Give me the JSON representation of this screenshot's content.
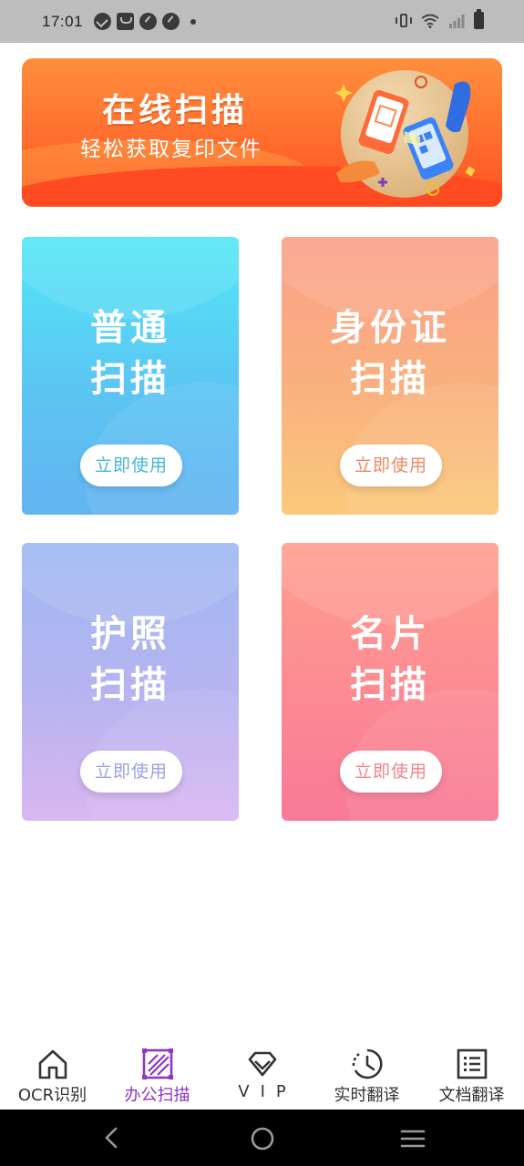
{
  "status_bar": {
    "time": "17:01"
  },
  "banner": {
    "title": "在线扫描",
    "subtitle": "轻松获取复印文件"
  },
  "cards": [
    {
      "title_line1": "普通",
      "title_line2": "扫描",
      "button": "立即使用"
    },
    {
      "title_line1": "身份证",
      "title_line2": "扫描",
      "button": "立即使用"
    },
    {
      "title_line1": "护照",
      "title_line2": "扫描",
      "button": "立即使用"
    },
    {
      "title_line1": "名片",
      "title_line2": "扫描",
      "button": "立即使用"
    }
  ],
  "bottom_nav": {
    "items": [
      {
        "label": "OCR识别",
        "icon": "home-icon"
      },
      {
        "label": "办公扫描",
        "icon": "scan-frame-icon",
        "active": true
      },
      {
        "label": "VIP",
        "icon": "diamond-icon"
      },
      {
        "label": "实时翻译",
        "icon": "clock-icon"
      },
      {
        "label": "文档翻译",
        "icon": "document-list-icon"
      }
    ]
  },
  "colors": {
    "active_tab": "#8e34c9",
    "banner_orange": "#ff6a2c"
  }
}
